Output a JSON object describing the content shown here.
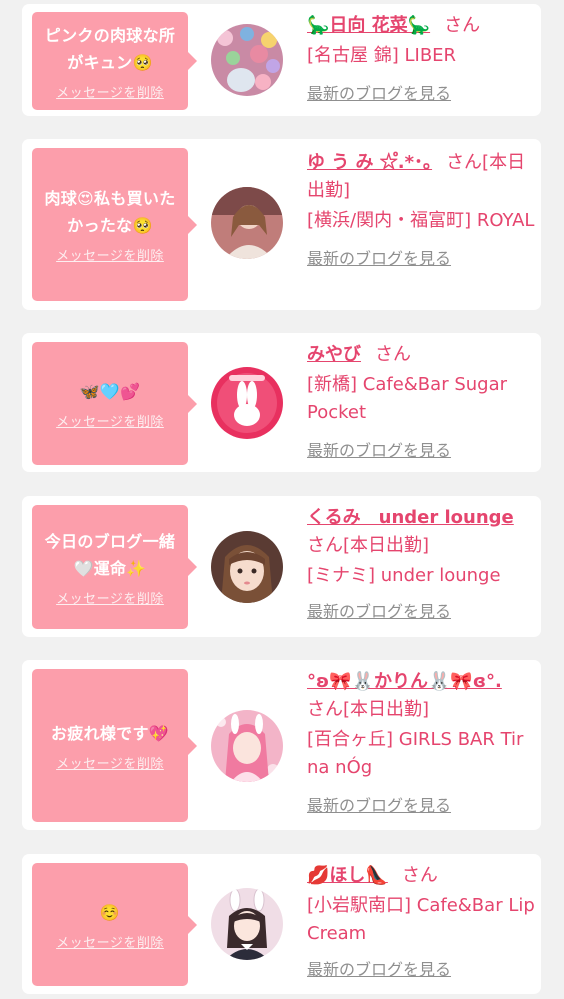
{
  "colors": {
    "background": "#f1f1f1",
    "card": "#ffffff",
    "bubble": "#fc9eab",
    "accent": "#e5456e",
    "link_gray": "#8f8f8f"
  },
  "entries": [
    {
      "message": "ピンクの肉球な所がキュン🥺",
      "delete_label": "メッセージを削除",
      "name": "🦕日向 花菜🦕",
      "honorific": "さん",
      "shop": "[名古屋 錦] LIBER",
      "blog_link": "最新のブログを見る"
    },
    {
      "message": "肉球😍私も買いたかったな🥺",
      "delete_label": "メッセージを削除",
      "name": "ゆ う み ☆゚.*･｡",
      "honorific": "さん[本日出勤]",
      "shop": "[横浜/関内・福富町] ROYAL",
      "blog_link": "最新のブログを見る"
    },
    {
      "message": "🦋🩵💕",
      "delete_label": "メッセージを削除",
      "name": "みやび",
      "honorific": "さん",
      "shop": "[新橋] Cafe&Bar Sugar Pocket",
      "blog_link": "最新のブログを見る"
    },
    {
      "message": "今日のブログ一緒🤍運命✨",
      "delete_label": "メッセージを削除",
      "name": "くるみ　under lounge",
      "honorific": "さん[本日出勤]",
      "shop": "[ミナミ] under lounge",
      "blog_link": "最新のブログを見る"
    },
    {
      "message": "お疲れ様です💖",
      "delete_label": "メッセージを削除",
      "name": "°ʚ🎀🐰かりん🐰🎀ɞ°.",
      "honorific": "さん[本日出勤]",
      "shop": "[百合ヶ丘] GIRLS BAR Tir na nÓg",
      "blog_link": "最新のブログを見る"
    },
    {
      "message": "☺️",
      "delete_label": "メッセージを削除",
      "name": "💋ほし👠",
      "honorific": "さん",
      "shop": "[小岩駅南口] Cafe&Bar Lip Cream",
      "blog_link": "最新のブログを見る"
    }
  ]
}
